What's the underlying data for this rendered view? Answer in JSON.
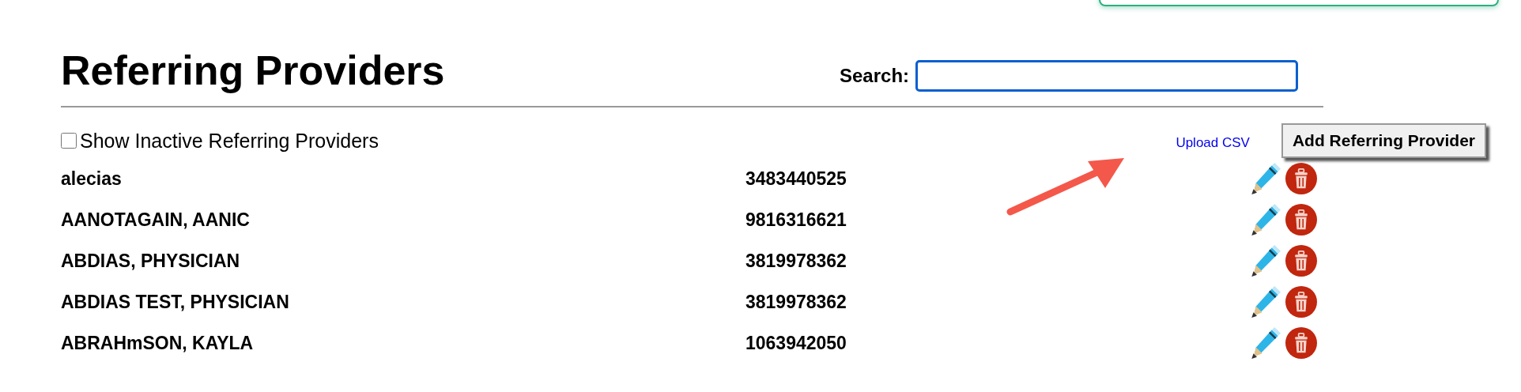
{
  "title": "Referring Providers",
  "search": {
    "label": "Search:"
  },
  "show_inactive": {
    "label": "Show Inactive Referring Providers",
    "checked": false
  },
  "upload_link": "Upload CSV",
  "add_button": "Add Referring Provider",
  "rows": [
    {
      "name": "alecias",
      "number": "3483440525"
    },
    {
      "name": "AANOTAGAIN, AANIC",
      "number": "9816316621"
    },
    {
      "name": "ABDIAS, PHYSICIAN",
      "number": "3819978362"
    },
    {
      "name": "ABDIAS TEST, PHYSICIAN",
      "number": "3819978362"
    },
    {
      "name": "ABRAHmSON, KAYLA",
      "number": "1063942050"
    }
  ]
}
